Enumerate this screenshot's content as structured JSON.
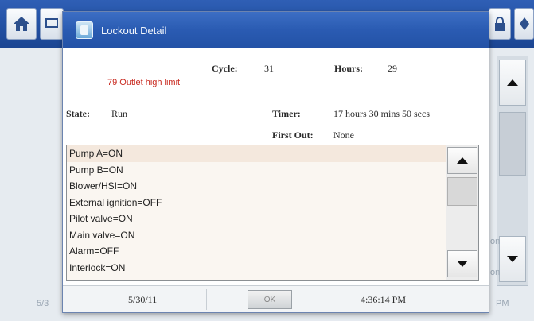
{
  "background": {
    "footer_left": "5/3",
    "footer_right": "PM",
    "side_text_1": "on",
    "side_text_2": "on"
  },
  "dialog": {
    "title": "Lockout Detail",
    "cycle_label": "Cycle:",
    "cycle_value": "31",
    "hours_label": "Hours:",
    "hours_value": "29",
    "error_message": "79 Outlet high limit",
    "state_label": "State:",
    "state_value": "Run",
    "timer_label": "Timer:",
    "timer_value": "17 hours 30 mins 50 secs",
    "first_out_label": "First Out:",
    "first_out_value": "None",
    "status_list": [
      "Pump A=ON",
      "Pump B=ON",
      "Blower/HSI=ON",
      "External ignition=OFF",
      "Pilot valve=ON",
      "Main valve=ON",
      "Alarm=OFF",
      "Interlock=ON"
    ],
    "footer": {
      "date": "5/30/11",
      "ok_label": "OK",
      "time": "4:36:14 PM"
    }
  },
  "icons": {
    "home": "home-icon",
    "app": "app-icon",
    "lock": "lock-icon",
    "nav": "diamond-icon",
    "up": "up-arrow-icon",
    "down": "down-arrow-icon"
  }
}
